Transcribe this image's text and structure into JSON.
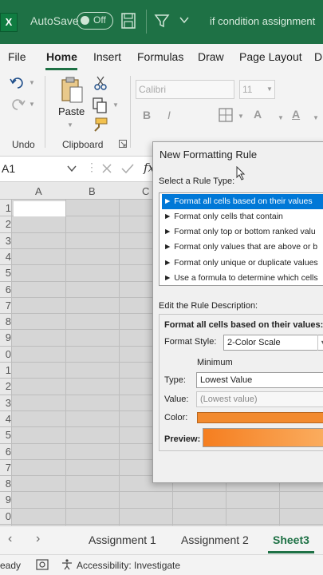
{
  "titlebar": {
    "logo": "X",
    "autosave_label": "AutoSave",
    "autosave_state": "Off",
    "doc_title": "if condition assignment"
  },
  "ribbon_tabs": [
    "File",
    "Home",
    "Insert",
    "Formulas",
    "Draw",
    "Page Layout",
    "D"
  ],
  "active_tab": "Home",
  "ribbon": {
    "undo_group": "Undo",
    "clipboard_group": "Clipboard",
    "paste_label": "Paste",
    "font_name": "Calibri",
    "font_size": "11",
    "bold": "B",
    "italic": "I",
    "font_color_glyph": "A",
    "highlight_glyph": "A"
  },
  "formula_bar": {
    "name_box": "A1",
    "fx": "fx"
  },
  "grid": {
    "columns": [
      "A",
      "B",
      "C"
    ],
    "rows": [
      "1",
      "2",
      "3",
      "4",
      "5",
      "6",
      "7",
      "8",
      "9",
      "0",
      "1",
      "2",
      "3",
      "4",
      "5",
      "6",
      "7",
      "8",
      "9",
      "0"
    ]
  },
  "sheet_tabs": [
    "Assignment 1",
    "Assignment 2",
    "Sheet3"
  ],
  "active_sheet": "Sheet3",
  "status": {
    "ready": "eady",
    "accessibility": "Accessibility: Investigate"
  },
  "dialog": {
    "title": "New Formatting Rule",
    "select_rule_type_label": "Select a Rule Type:",
    "rule_types": [
      "► Format all cells based on their values",
      "► Format only cells that contain",
      "► Format only top or bottom ranked valu",
      "► Format only values that are above or b",
      "► Format only unique or duplicate values",
      "► Use a formula to determine which cells"
    ],
    "edit_rule_label": "Edit the Rule Description:",
    "desc_heading": "Format all cells based on their values:",
    "format_style_label": "Format Style:",
    "format_style_value": "2-Color Scale",
    "minimum_label": "Minimum",
    "type_label": "Type:",
    "type_value": "Lowest Value",
    "value_label": "Value:",
    "value_placeholder": "(Lowest value)",
    "color_label": "Color:",
    "preview_label": "Preview:",
    "colors": {
      "minimum_color": "#f28a2e",
      "selected_rule_bg": "#0078d7",
      "excel_green": "#1e7145"
    }
  }
}
